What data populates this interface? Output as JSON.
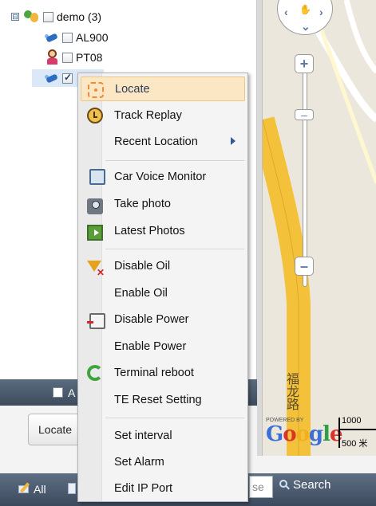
{
  "tree": {
    "group": {
      "label": "demo (3)",
      "expander": "⊟"
    },
    "devices": [
      {
        "label": "AL900"
      },
      {
        "label": "PT08"
      },
      {
        "label": ""
      }
    ],
    "footer_label": "A"
  },
  "locate_button": {
    "label": "Locate"
  },
  "map": {
    "road_label": "福龙路",
    "powered_by": "POWERED BY",
    "google": [
      "G",
      "o",
      "o",
      "g",
      "l",
      "e"
    ],
    "google_colors": [
      "#3a6fd8",
      "#d8342a",
      "#f2b01e",
      "#3a6fd8",
      "#2f9e44",
      "#d8342a"
    ],
    "scale_top": "1000",
    "scale_bottom": "500 米"
  },
  "context_menu": {
    "items": [
      {
        "label": "Locate",
        "icon": "locate-icon",
        "highlighted": true
      },
      {
        "label": "Track Replay",
        "icon": "track-replay-icon"
      },
      {
        "label": "Recent Location",
        "icon": "",
        "submenu": true
      },
      {
        "label": "Car Voice Monitor",
        "icon": "phone-icon"
      },
      {
        "label": "Take photo",
        "icon": "camera-icon"
      },
      {
        "label": "Latest Photos",
        "icon": "photos-icon"
      },
      {
        "label": "Disable Oil",
        "icon": "disable-oil-icon"
      },
      {
        "label": "Enable Oil",
        "icon": ""
      },
      {
        "label": "Disable Power",
        "icon": "disable-power-icon"
      },
      {
        "label": "Enable Power",
        "icon": ""
      },
      {
        "label": "Terminal reboot",
        "icon": "reboot-icon"
      },
      {
        "label": "TE Reset Setting",
        "icon": ""
      },
      {
        "label": "Set interval",
        "icon": ""
      },
      {
        "label": "Set Alarm",
        "icon": ""
      },
      {
        "label": "Edit IP Port",
        "icon": ""
      }
    ]
  },
  "bottom_bar": {
    "all_label": "All",
    "search_placeholder": "se",
    "search_label": "Search"
  },
  "colors": {
    "highlight": "#fbe7c3",
    "toolbar": "#4a5a6e",
    "road": "#f3c23a"
  }
}
